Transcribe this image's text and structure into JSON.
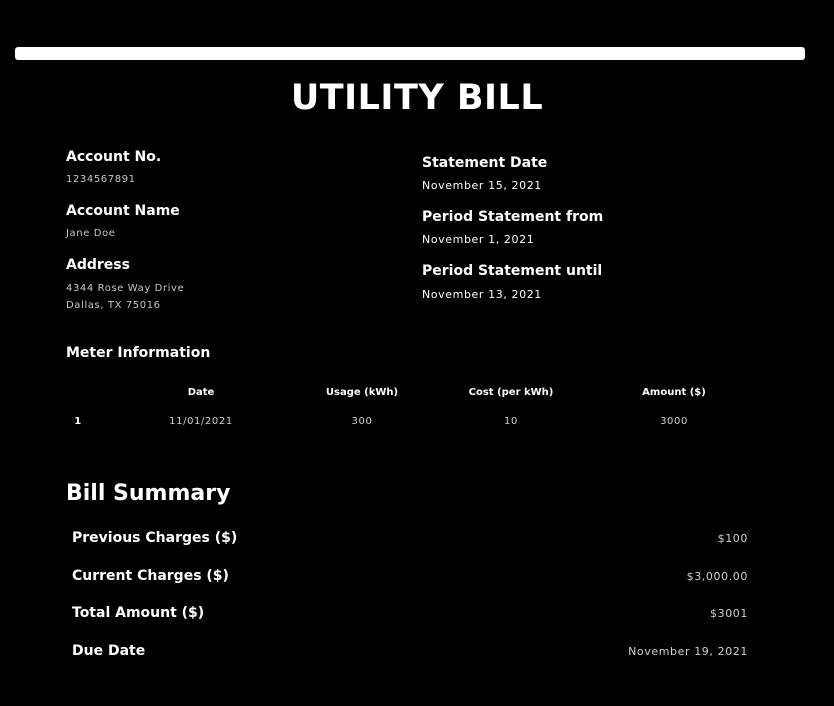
{
  "title": "UTILITY BILL",
  "account": {
    "number_label": "Account No.",
    "number_value": "1234567891",
    "name_label": "Account Name",
    "name_value": "Jane Doe",
    "address_label": "Address",
    "address_line1": "4344 Rose Way Drive",
    "address_line2": "Dallas, TX 75016"
  },
  "statement": {
    "date_label": "Statement Date",
    "date_value": "November 15, 2021",
    "from_label": "Period Statement from",
    "from_value": "November 1, 2021",
    "until_label": "Period Statement until",
    "until_value": "November 13, 2021"
  },
  "meter": {
    "label": "Meter Information",
    "headers": [
      "Date",
      "Usage (kWh)",
      "Cost (per kWh)",
      "Amount ($)"
    ],
    "rows": [
      {
        "index": "1",
        "date": "11/01/2021",
        "usage": "300",
        "cost": "10",
        "amount": "3000"
      }
    ]
  },
  "summary": {
    "title": "Bill Summary",
    "previous_label": "Previous Charges ($)",
    "previous_value": "$100",
    "current_label": "Current Charges ($)",
    "current_value": "$3,000.00",
    "total_label": "Total Amount ($)",
    "total_value": "$3001",
    "due_label": "Due Date",
    "due_value": "November 19, 2021"
  }
}
